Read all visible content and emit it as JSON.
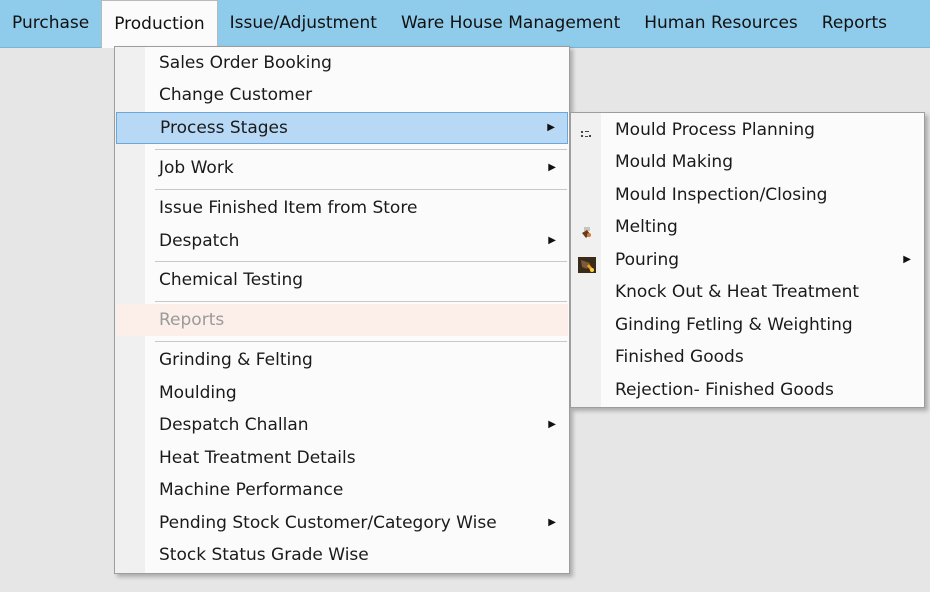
{
  "menubar": {
    "items": [
      {
        "label": "Purchase"
      },
      {
        "label": "Production"
      },
      {
        "label": "Issue/Adjustment"
      },
      {
        "label": "Ware House Management"
      },
      {
        "label": "Human Resources"
      },
      {
        "label": "Reports"
      }
    ]
  },
  "production_menu": {
    "items": [
      {
        "label": "Sales Order Booking"
      },
      {
        "label": "Change Customer"
      },
      {
        "label": "Process Stages",
        "submenu": true,
        "selected": true
      },
      {
        "label": "Job Work",
        "submenu": true
      },
      {
        "label": "Issue Finished Item from Store"
      },
      {
        "label": "Despatch",
        "submenu": true
      },
      {
        "label": "Chemical Testing"
      },
      {
        "label": "Reports",
        "disabled": true
      },
      {
        "label": "Grinding & Felting"
      },
      {
        "label": "Moulding"
      },
      {
        "label": "Despatch Challan",
        "submenu": true
      },
      {
        "label": "Heat Treatment Details"
      },
      {
        "label": "Machine Performance"
      },
      {
        "label": "Pending Stock Customer/Category Wise",
        "submenu": true
      },
      {
        "label": "Stock Status Grade Wise"
      }
    ]
  },
  "process_stages_menu": {
    "items": [
      {
        "label": "Mould Process Planning",
        "icon": "planning-icon"
      },
      {
        "label": "Mould Making"
      },
      {
        "label": "Mould Inspection/Closing"
      },
      {
        "label": "Melting",
        "icon": "melting-icon"
      },
      {
        "label": "Pouring",
        "icon": "pouring-icon",
        "submenu": true
      },
      {
        "label": "Knock Out & Heat Treatment"
      },
      {
        "label": "Ginding Fetling & Weighting"
      },
      {
        "label": "Finished Goods"
      },
      {
        "label": "Rejection- Finished Goods"
      }
    ]
  },
  "arrow_glyph": "▶",
  "colors": {
    "menubar": "#8fcbea",
    "selected_item": "#b8d9f6",
    "disabled_item": "#fcefe9"
  }
}
